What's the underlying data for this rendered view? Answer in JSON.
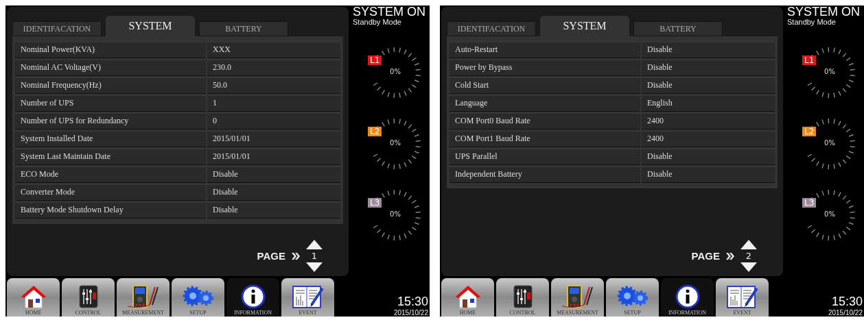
{
  "screens": [
    {
      "tabs": [
        {
          "label": "IDENTIFACATION",
          "selected": false
        },
        {
          "label": "SYSTEM",
          "selected": true
        },
        {
          "label": "BATTERY",
          "selected": false
        }
      ],
      "rows": [
        {
          "label": "Nominal Power(KVA)",
          "value": "XXX"
        },
        {
          "label": "Nominal AC Voltage(V)",
          "value": "230.0"
        },
        {
          "label": "Nominal Frequency(Hz)",
          "value": "50.0"
        },
        {
          "label": "Number of UPS",
          "value": "1"
        },
        {
          "label": "Number of UPS for Redundancy",
          "value": "0"
        },
        {
          "label": "System Installed Date",
          "value": "2015/01/01"
        },
        {
          "label": "System Last Maintain Date",
          "value": "2015/01/01"
        },
        {
          "label": "ECO Mode",
          "value": "Disable"
        },
        {
          "label": "Converter Mode",
          "value": "Disable"
        },
        {
          "label": "Battery Mode Shutdown Delay",
          "value": "Disable"
        }
      ],
      "page": {
        "label": "PAGE",
        "number": "1"
      },
      "status": {
        "title": "SYSTEM ON",
        "mode": "Standby Mode"
      },
      "phases": [
        {
          "label": "L1",
          "color": "#e01515",
          "reading": "0%"
        },
        {
          "label": "L2",
          "color": "#f08a10",
          "reading": "0%"
        },
        {
          "label": "L3",
          "color": "#a08aa0",
          "reading": "0%"
        }
      ],
      "nav": [
        {
          "label": "HOME",
          "kind": "home",
          "selected": false
        },
        {
          "label": "CONTROL",
          "kind": "control",
          "selected": false
        },
        {
          "label": "MEASUREMENT",
          "kind": "meter",
          "selected": false
        },
        {
          "label": "SETUP",
          "kind": "gears",
          "selected": false
        },
        {
          "label": "INFORMATION",
          "kind": "info",
          "selected": true
        },
        {
          "label": "EVENT",
          "kind": "log",
          "selected": false
        }
      ],
      "clock": {
        "time": "15:30",
        "date": "2015/10/22"
      }
    },
    {
      "tabs": [
        {
          "label": "IDENTIFACATION",
          "selected": false
        },
        {
          "label": "SYSTEM",
          "selected": true
        },
        {
          "label": "BATTERY",
          "selected": false
        }
      ],
      "rows": [
        {
          "label": "Auto-Restart",
          "value": "Disable"
        },
        {
          "label": "Power by Bypass",
          "value": "Disable"
        },
        {
          "label": "Cold Start",
          "value": "Disable"
        },
        {
          "label": "Language",
          "value": "English"
        },
        {
          "label": "COM Port0 Baud Rate",
          "value": "2400"
        },
        {
          "label": "COM Port1 Baud Rate",
          "value": "2400"
        },
        {
          "label": "UPS Parallel",
          "value": "Disable"
        },
        {
          "label": "Independent Battery",
          "value": "Disable"
        }
      ],
      "page": {
        "label": "PAGE",
        "number": "2"
      },
      "status": {
        "title": "SYSTEM ON",
        "mode": "Standby Mode"
      },
      "phases": [
        {
          "label": "L1",
          "color": "#e01515",
          "reading": "0%"
        },
        {
          "label": "L2",
          "color": "#f08a10",
          "reading": "0%"
        },
        {
          "label": "L3",
          "color": "#a08aa0",
          "reading": "0%"
        }
      ],
      "nav": [
        {
          "label": "HOME",
          "kind": "home",
          "selected": false
        },
        {
          "label": "CONTROL",
          "kind": "control",
          "selected": false
        },
        {
          "label": "MEASUREMENT",
          "kind": "meter",
          "selected": false
        },
        {
          "label": "SETUP",
          "kind": "gears",
          "selected": false
        },
        {
          "label": "INFORMATION",
          "kind": "info",
          "selected": true
        },
        {
          "label": "EVENT",
          "kind": "log",
          "selected": false
        }
      ],
      "clock": {
        "time": "15:30",
        "date": "2015/10/22"
      }
    }
  ]
}
